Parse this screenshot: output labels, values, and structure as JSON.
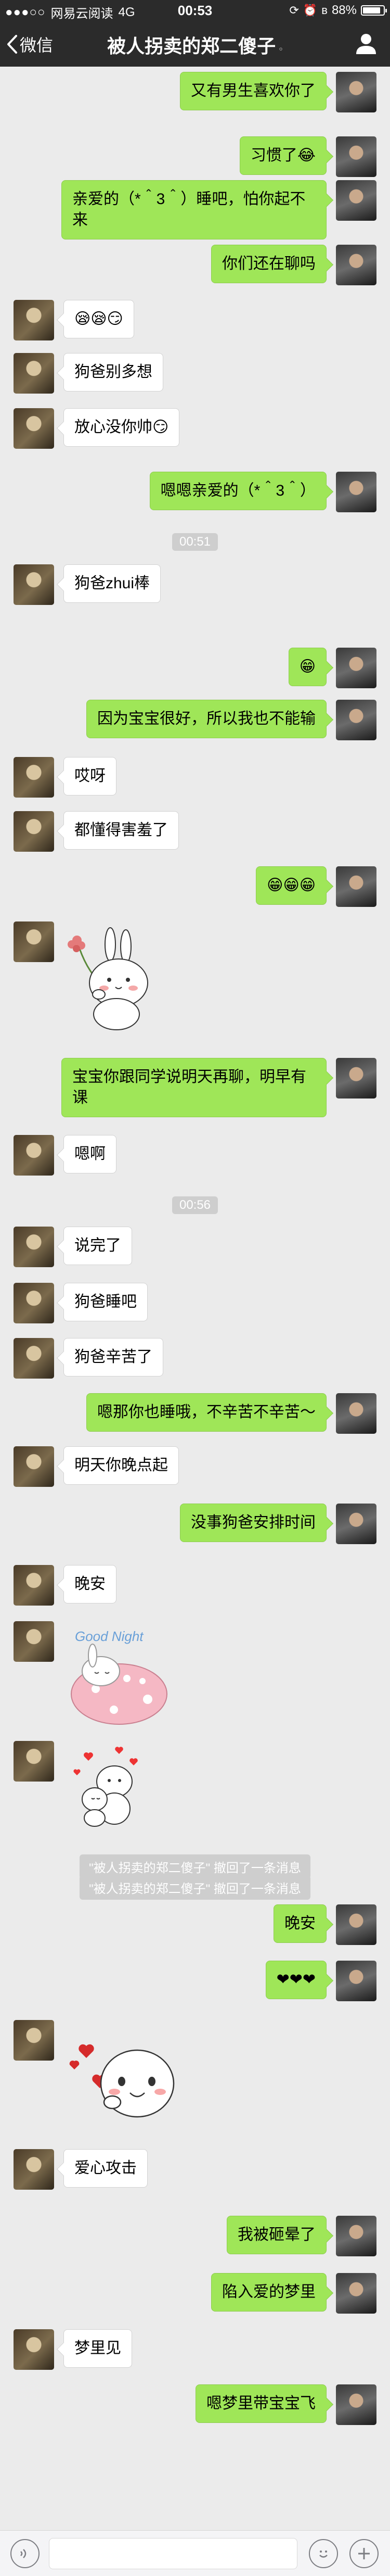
{
  "status_bar": {
    "carrier": "网易云阅读",
    "network": "4G",
    "time": "00:53",
    "battery": "88%",
    "battery_level": 0.88
  },
  "nav": {
    "back_label": "微信",
    "title": "被人拐卖的郑二傻子"
  },
  "messages": [
    {
      "side": "me",
      "text": "又有男生喜欢你了"
    },
    {
      "side": "me",
      "text": "习惯了😂"
    },
    {
      "side": "me",
      "text": "亲爱的（*＾3＾）睡吧，怕你起不来"
    },
    {
      "side": "me",
      "text": "你们还在聊吗"
    },
    {
      "side": "them",
      "text": "😪😪😏"
    },
    {
      "side": "them",
      "text": "狗爸别多想"
    },
    {
      "side": "them",
      "text": "放心没你帅😏"
    },
    {
      "side": "me",
      "text": "嗯嗯亲爱的（*＾3＾）"
    },
    {
      "side": "time",
      "text": "00:51"
    },
    {
      "side": "them",
      "text": "狗爸zhui棒"
    },
    {
      "side": "me",
      "text": "😁"
    },
    {
      "side": "me",
      "text": "因为宝宝很好，所以我也不能输"
    },
    {
      "side": "them",
      "text": "哎呀"
    },
    {
      "side": "them",
      "text": "都懂得害羞了"
    },
    {
      "side": "me",
      "text": "😁😁😁"
    },
    {
      "side": "them",
      "sticker": "bunny-flower-sticker"
    },
    {
      "side": "me",
      "text": "宝宝你跟同学说明天再聊，明早有课"
    },
    {
      "side": "them",
      "text": "嗯啊"
    },
    {
      "side": "time",
      "text": "00:56"
    },
    {
      "side": "them",
      "text": "说完了"
    },
    {
      "side": "them",
      "text": "狗爸睡吧"
    },
    {
      "side": "them",
      "text": "狗爸辛苦了"
    },
    {
      "side": "me",
      "text": "嗯那你也睡哦，不辛苦不辛苦～"
    },
    {
      "side": "them",
      "text": "明天你晚点起"
    },
    {
      "side": "me",
      "text": "没事狗爸安排时间"
    },
    {
      "side": "them",
      "text": "晚安"
    },
    {
      "side": "them",
      "sticker": "good-night-sticker",
      "sticker_text": "Good Night"
    },
    {
      "side": "them",
      "sticker": "hearts-hug-sticker"
    },
    {
      "side": "recall",
      "text": "\"被人拐卖的郑二傻子\" 撤回了一条消息"
    },
    {
      "side": "recall",
      "text": "\"被人拐卖的郑二傻子\" 撤回了一条消息"
    },
    {
      "side": "me",
      "text": "晚安"
    },
    {
      "side": "me",
      "text": "❤❤❤"
    },
    {
      "side": "them",
      "sticker": "heart-attack-sticker"
    },
    {
      "side": "them",
      "text": "爱心攻击"
    },
    {
      "side": "me",
      "text": "我被砸晕了"
    },
    {
      "side": "me",
      "text": "陷入爱的梦里"
    },
    {
      "side": "them",
      "text": "梦里见"
    },
    {
      "side": "me",
      "text": "嗯梦里带宝宝飞"
    }
  ]
}
